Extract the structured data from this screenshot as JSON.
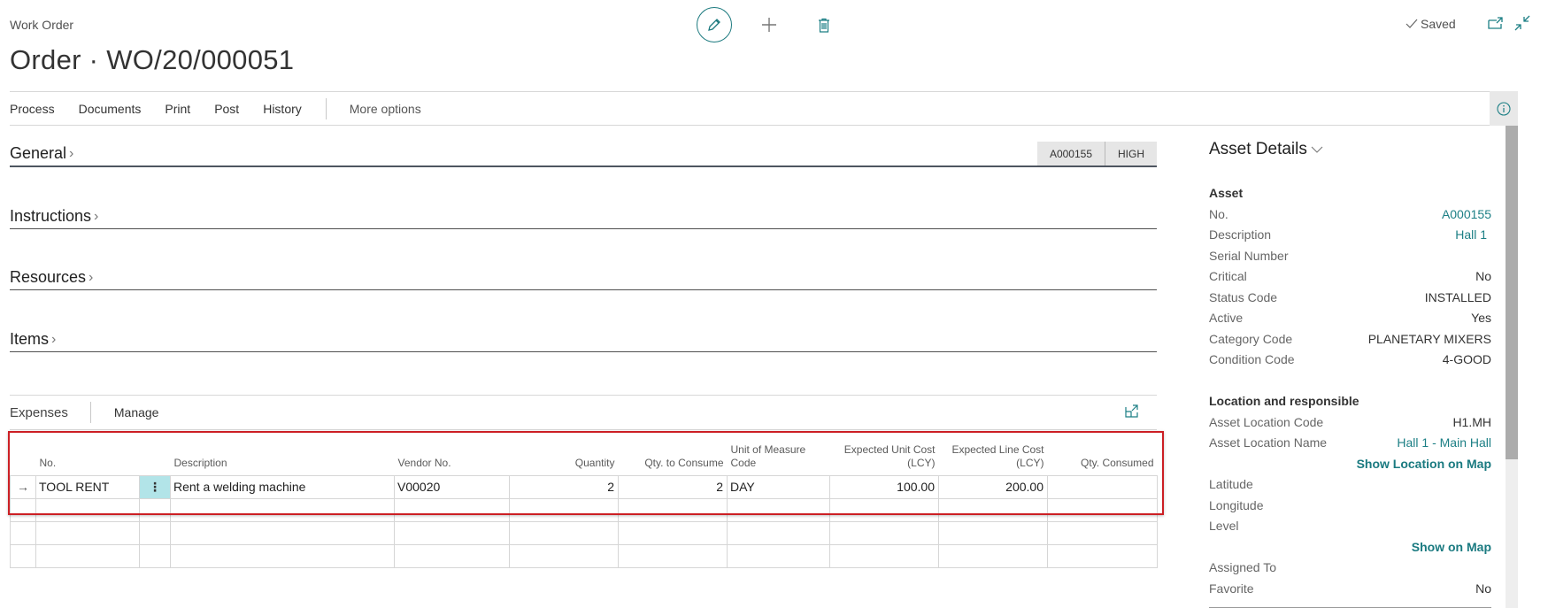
{
  "header": {
    "breadcrumb": "Work Order",
    "title": "Order · WO/20/000051",
    "saved_label": "Saved",
    "icons": {
      "edit": "pencil-icon",
      "new": "plus-icon",
      "delete": "trash-icon",
      "popout": "open-in-new-window-icon",
      "collapse": "collapse-icon",
      "info": "info-icon"
    }
  },
  "actionbar": {
    "items": [
      "Process",
      "Documents",
      "Print",
      "Post",
      "History"
    ],
    "more": "More options"
  },
  "fasttabs": {
    "general": {
      "label": "General",
      "badges": [
        "A000155",
        "HIGH"
      ]
    },
    "instructions": {
      "label": "Instructions"
    },
    "resources": {
      "label": "Resources"
    },
    "items": {
      "label": "Items"
    }
  },
  "expenses": {
    "title": "Expenses",
    "manage": "Manage",
    "columns": [
      "No.",
      "Description",
      "Vendor No.",
      "Quantity",
      "Qty. to Consume",
      "Unit of Measure Code",
      "Expected Unit Cost (LCY)",
      "Expected Line Cost (LCY)",
      "Qty. Consumed"
    ],
    "rows": [
      {
        "no": "TOOL RENT",
        "description": "Rent a welding machine",
        "vendor_no": "V00020",
        "quantity": "2",
        "qty_to_consume": "2",
        "uom": "DAY",
        "unit_cost": "100.00",
        "line_cost": "200.00",
        "qty_consumed": ""
      }
    ]
  },
  "asset_panel": {
    "title": "Asset Details",
    "asset_group": "Asset",
    "asset": [
      {
        "label": "No.",
        "value": "A000155",
        "style": "link"
      },
      {
        "label": "Description",
        "value": "Hall 1",
        "style": "link"
      },
      {
        "label": "Serial Number",
        "value": ""
      },
      {
        "label": "Critical",
        "value": "No"
      },
      {
        "label": "Status Code",
        "value": "INSTALLED"
      },
      {
        "label": "Active",
        "value": "Yes"
      },
      {
        "label": "Category Code",
        "value": "PLANETARY MIXERS"
      },
      {
        "label": "Condition Code",
        "value": "4-GOOD"
      }
    ],
    "location_group": "Location and responsible",
    "location": [
      {
        "label": "Asset Location Code",
        "value": "H1.MH"
      },
      {
        "label": "Asset Location Name",
        "value": "Hall 1 - Main Hall",
        "style": "link"
      }
    ],
    "show_location_map": "Show Location on Map",
    "coords": [
      {
        "label": "Latitude",
        "value": ""
      },
      {
        "label": "Longitude",
        "value": ""
      },
      {
        "label": "Level",
        "value": ""
      }
    ],
    "show_on_map": "Show on Map",
    "other": [
      {
        "label": "Assigned To",
        "value": ""
      },
      {
        "label": "Favorite",
        "value": "No"
      }
    ]
  },
  "colors": {
    "accent": "#1c7f85",
    "highlight_box": "#cc1f24",
    "selected_cell": "#b2e4e8"
  }
}
